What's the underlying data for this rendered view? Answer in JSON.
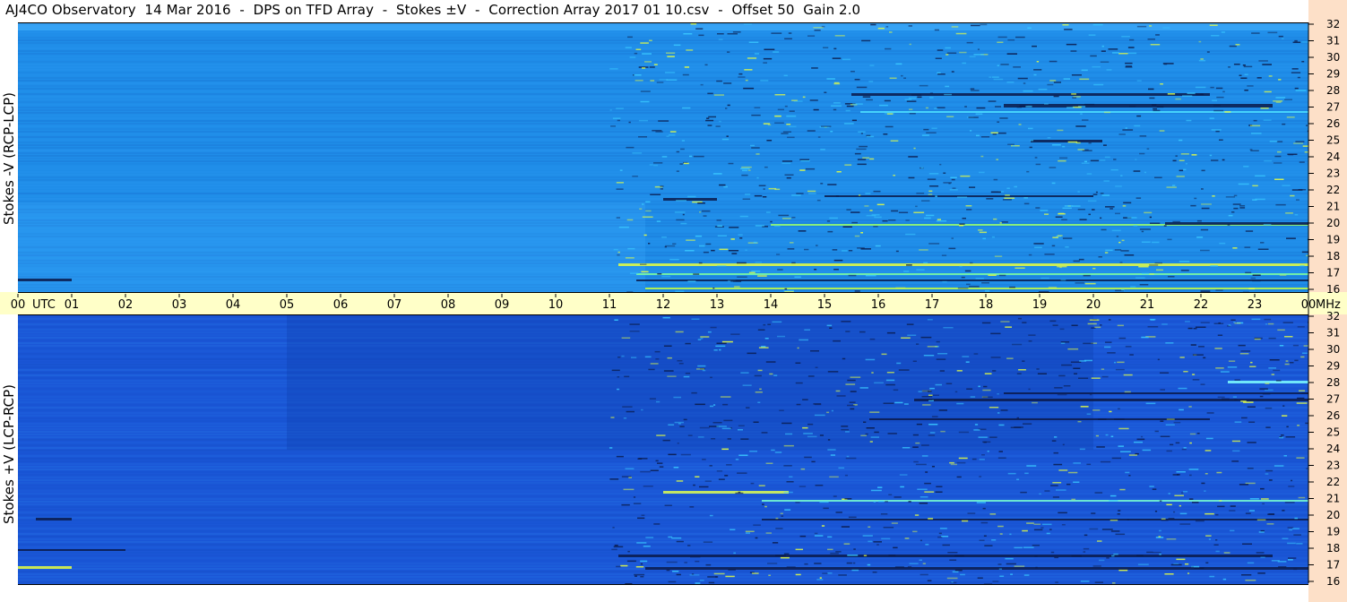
{
  "title": "AJ4CO Observatory  14 Mar 2016  -  DPS on TFD Array  -  Stokes ±V  -  Correction Array 2017 01 10.csv  -  Offset 50  Gain 2.0",
  "colors": {
    "axis_strip": "#ffffc8",
    "freq_strip": "#fde0c8",
    "panel_top_bg": "#1f8de8",
    "panel_bottom_bg": "#1a56d6",
    "burst_dark": "#0a1a4a",
    "burst_bright": "#e8ff40"
  },
  "chart_data": [
    {
      "type": "heatmap",
      "panel": "top",
      "ylabel": "Stokes -V (RCP-LCP)",
      "xlabel": "UTC",
      "x_unit": "UTC",
      "y_unit": "MHz",
      "xlim": [
        0,
        24
      ],
      "ylim": [
        16,
        32
      ],
      "yticks": [
        "16",
        "17",
        "18",
        "19",
        "20",
        "21",
        "22",
        "23",
        "24",
        "25",
        "26",
        "27",
        "28",
        "29",
        "30",
        "31",
        "32"
      ]
    },
    {
      "type": "heatmap",
      "panel": "bottom",
      "ylabel": "Stokes +V (LCP-RCP)",
      "xlabel": "UTC",
      "x_unit": "UTC",
      "y_unit": "MHz",
      "xlim": [
        0,
        24
      ],
      "ylim": [
        16,
        32
      ],
      "yticks": [
        "16",
        "17",
        "18",
        "19",
        "20",
        "21",
        "22",
        "23",
        "24",
        "25",
        "26",
        "27",
        "28",
        "29",
        "30",
        "31",
        "32"
      ]
    }
  ],
  "time_axis": {
    "labels": [
      "00",
      "01",
      "02",
      "03",
      "04",
      "05",
      "06",
      "07",
      "08",
      "09",
      "10",
      "11",
      "12",
      "13",
      "14",
      "15",
      "16",
      "17",
      "18",
      "19",
      "20",
      "21",
      "22",
      "23",
      "00"
    ],
    "unit_label": "UTC",
    "freq_unit_label": "MHz"
  }
}
